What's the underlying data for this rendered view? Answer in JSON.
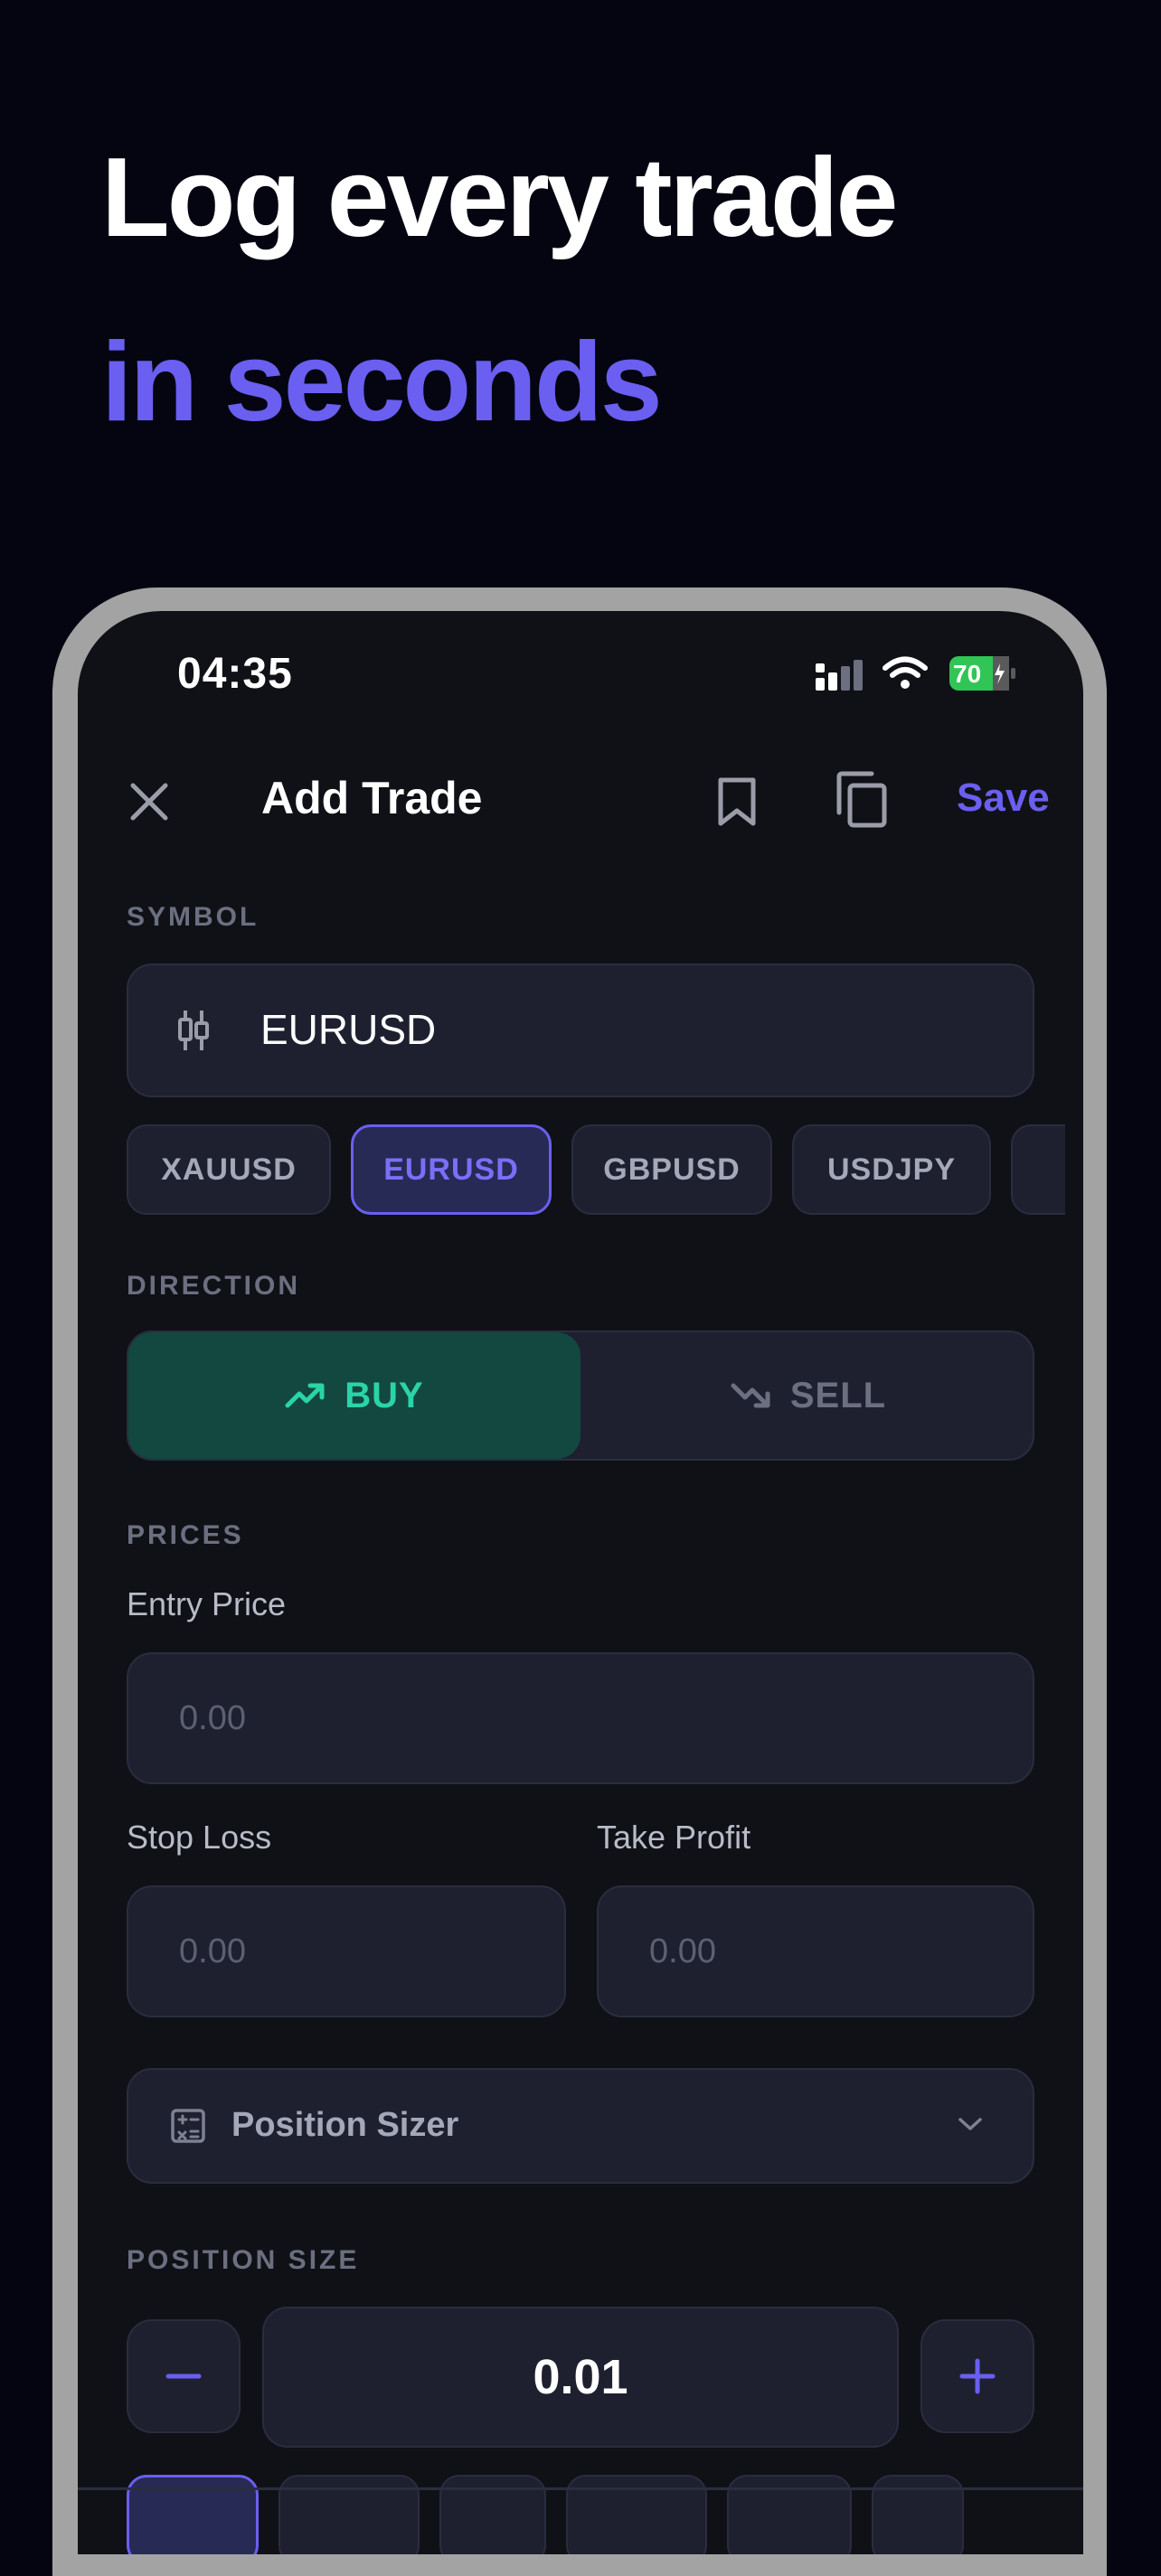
{
  "hero": {
    "line1": "Log every trade",
    "line2": "in seconds"
  },
  "status_bar": {
    "time": "04:35",
    "battery": "70"
  },
  "header": {
    "title": "Add Trade",
    "save_label": "Save"
  },
  "symbol": {
    "section_label": "SYMBOL",
    "value": "EURUSD",
    "chips": [
      "XAUUSD",
      "EURUSD",
      "GBPUSD",
      "USDJPY"
    ],
    "selected": "EURUSD"
  },
  "direction": {
    "section_label": "DIRECTION",
    "buy_label": "BUY",
    "sell_label": "SELL",
    "selected": "BUY"
  },
  "prices": {
    "section_label": "PRICES",
    "entry_label": "Entry Price",
    "entry_placeholder": "0.00",
    "stop_label": "Stop Loss",
    "stop_placeholder": "0.00",
    "take_label": "Take Profit",
    "take_placeholder": "0.00"
  },
  "position_sizer": {
    "label": "Position Sizer"
  },
  "position_size": {
    "section_label": "POSITION SIZE",
    "value": "0.01"
  },
  "colors": {
    "background": "#050511",
    "accent": "#6a5ff0",
    "buy": "#2ad4a8",
    "panel": "#1e2030"
  },
  "icons": [
    "close-icon",
    "bookmark-icon",
    "copy-icon",
    "candlestick-icon",
    "trending-up-icon",
    "trending-down-icon",
    "calculator-icon",
    "chevron-down-icon",
    "minus-icon",
    "plus-icon"
  ]
}
